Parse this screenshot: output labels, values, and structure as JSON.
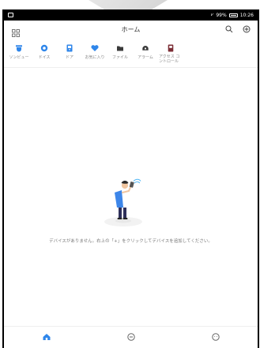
{
  "status": {
    "wifi": "⩗",
    "battery": "99%",
    "time": "10:26"
  },
  "header": {
    "title": "ホーム"
  },
  "shortcuts": [
    {
      "label": "ソンビュー"
    },
    {
      "label": "ドイス"
    },
    {
      "label": "ドア"
    },
    {
      "label": "お気に入り"
    },
    {
      "label": "ファイル"
    },
    {
      "label": "アラーム"
    },
    {
      "label": "アクセス コントロール"
    }
  ],
  "empty_state": {
    "message": "デバイスがありません。右上の「+」をクリックしてデバイスを追加してください。"
  },
  "tabs": [
    {
      "label": ""
    },
    {
      "label": ""
    },
    {
      "label": ""
    }
  ],
  "colors": {
    "accent": "#2f86ea",
    "text": "#333333",
    "muted": "#8f8f8f"
  }
}
